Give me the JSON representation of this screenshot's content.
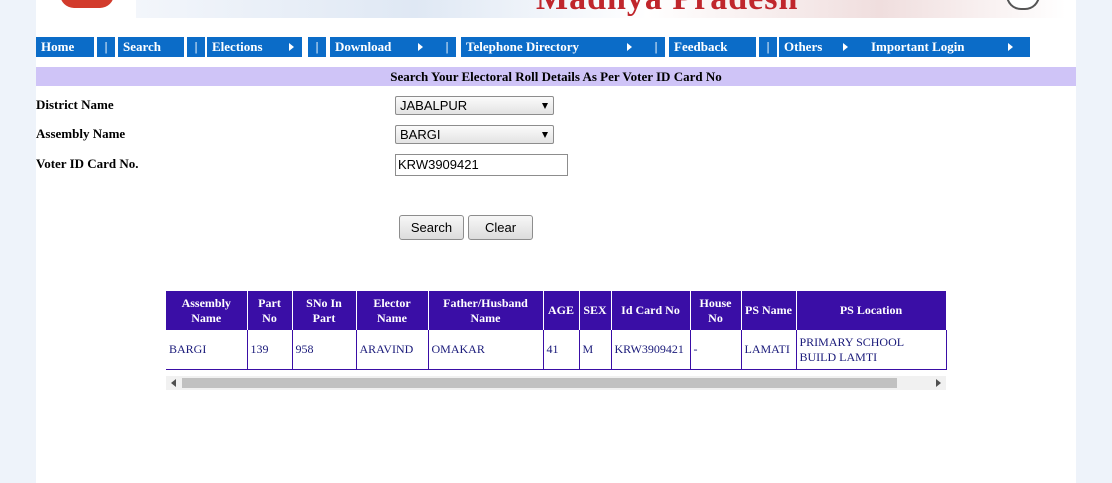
{
  "banner": {
    "title": "Madhya Pradesh"
  },
  "nav": {
    "items": [
      {
        "label": "Home"
      },
      {
        "label": "Search"
      },
      {
        "label": "Elections"
      },
      {
        "label": "Download"
      },
      {
        "label": "Telephone Directory"
      },
      {
        "label": "Feedback"
      },
      {
        "label": "Others"
      },
      {
        "label": "Important Login"
      }
    ],
    "separator": "|"
  },
  "form": {
    "heading": "Search Your Electoral Roll Details As Per Voter ID Card No",
    "district_label": "District Name",
    "district_value": "JABALPUR",
    "assembly_label": "Assembly Name",
    "assembly_value": "BARGI",
    "voter_id_label": "Voter ID Card No.",
    "voter_id_value": "KRW3909421",
    "search_button": "Search",
    "clear_button": "Clear"
  },
  "results": {
    "columns": [
      "Assembly Name",
      "Part No",
      "SNo In Part",
      "Elector Name",
      "Father/Husband Name",
      "AGE",
      "SEX",
      "Id Card No",
      "House No",
      "PS Name",
      "PS Location"
    ],
    "rows": [
      [
        "BARGI",
        "139",
        "958",
        "ARAVIND",
        "OMAKAR",
        "41",
        "M",
        "KRW3909421",
        "-",
        "LAMATI",
        "PRIMARY SCHOOL BUILD LAMTI"
      ]
    ]
  },
  "colors": {
    "nav": "#0b6cc8",
    "header_band": "#cfc4f7",
    "table_header": "#3a0ea6"
  }
}
